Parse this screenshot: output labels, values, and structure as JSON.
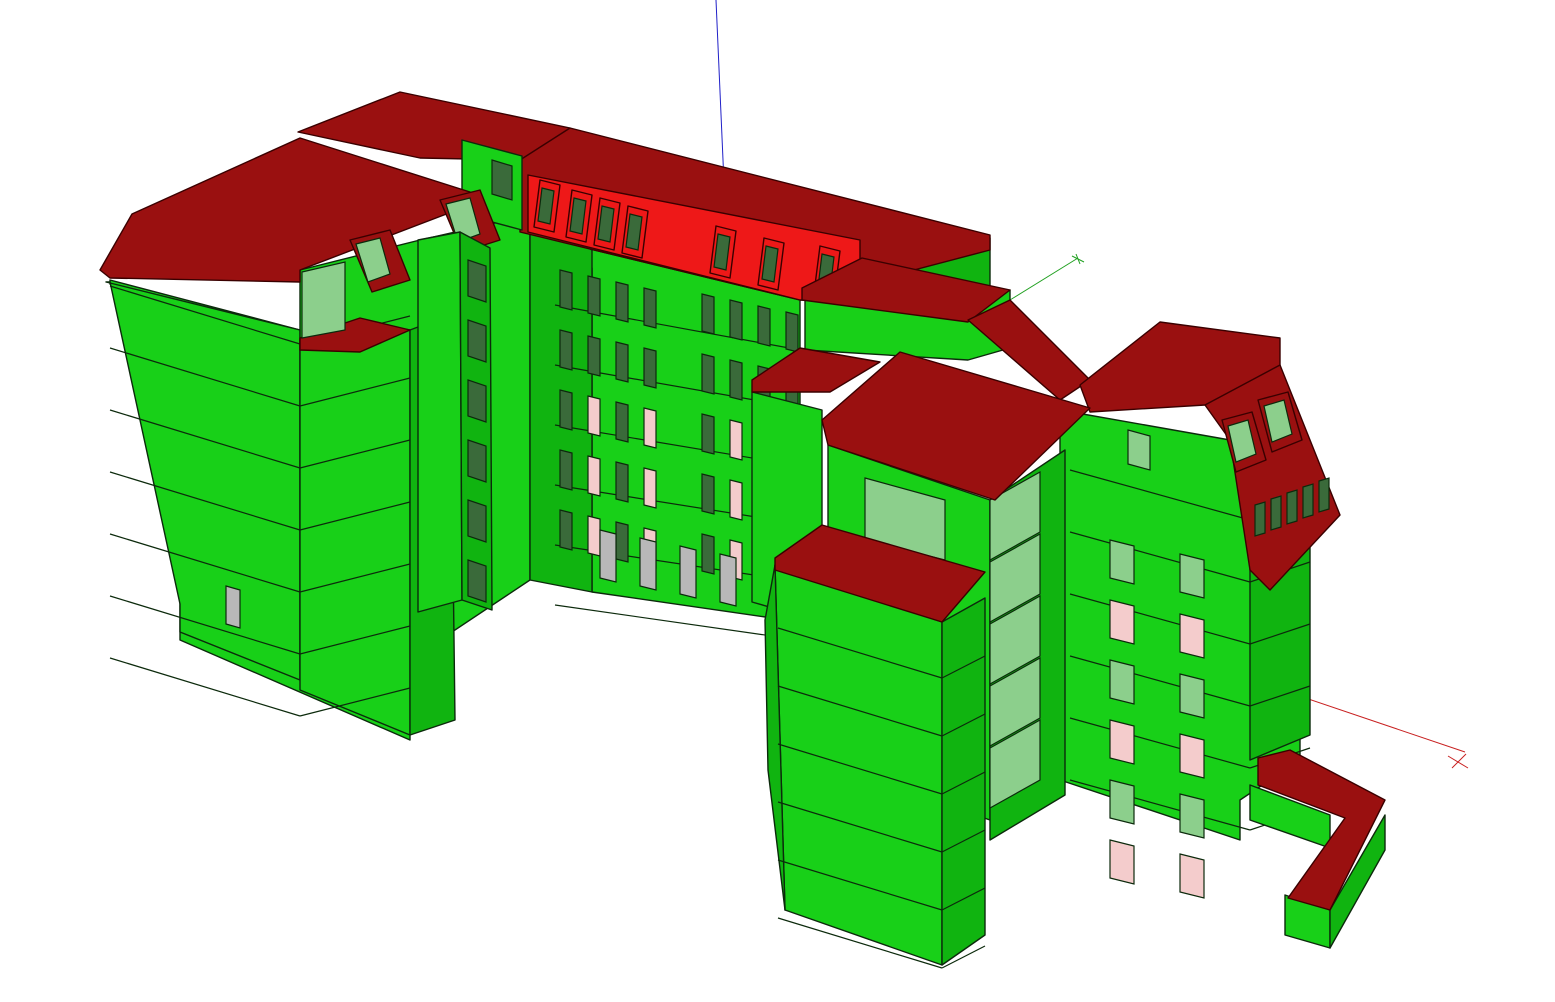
{
  "scene": {
    "background": "#ffffff",
    "colors": {
      "wall": "#18d018",
      "wall_shade": "#10b410",
      "wall_dark": "#0c9a0c",
      "roof": "#9a1010",
      "roof_bright": "#ee1818",
      "glass": "#8ccf8c",
      "window_dark": "#3a6a3a",
      "window_pink": "#f4cccc",
      "window_grey": "#b8b8b8",
      "edge": "#0c2a0c"
    }
  },
  "axes": {
    "x_axis_color": "#c82020",
    "y_axis_color": "#20a020",
    "z_axis_color": "#2020c8",
    "x_label": "X",
    "y_label": "Y"
  }
}
